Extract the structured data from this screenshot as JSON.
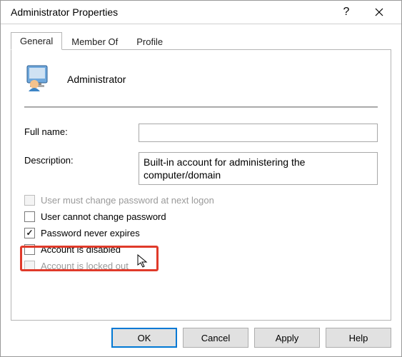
{
  "window": {
    "title": "Administrator Properties"
  },
  "tabs": {
    "general": "General",
    "memberof": "Member Of",
    "profile": "Profile",
    "active": "general"
  },
  "account": {
    "name": "Administrator"
  },
  "form": {
    "fullname_label": "Full name:",
    "fullname_value": "",
    "description_label": "Description:",
    "description_value": "Built-in account for administering the computer/domain"
  },
  "checks": {
    "must_change": {
      "label": "User must change password at next logon",
      "checked": false,
      "enabled": false
    },
    "cannot_change": {
      "label": "User cannot change password",
      "checked": false,
      "enabled": true
    },
    "never_expires": {
      "label": "Password never expires",
      "checked": true,
      "enabled": true
    },
    "disabled": {
      "label": "Account is disabled",
      "checked": false,
      "enabled": true
    },
    "locked": {
      "label": "Account is locked out",
      "checked": false,
      "enabled": false
    }
  },
  "buttons": {
    "ok": "OK",
    "cancel": "Cancel",
    "apply": "Apply",
    "help": "Help"
  }
}
